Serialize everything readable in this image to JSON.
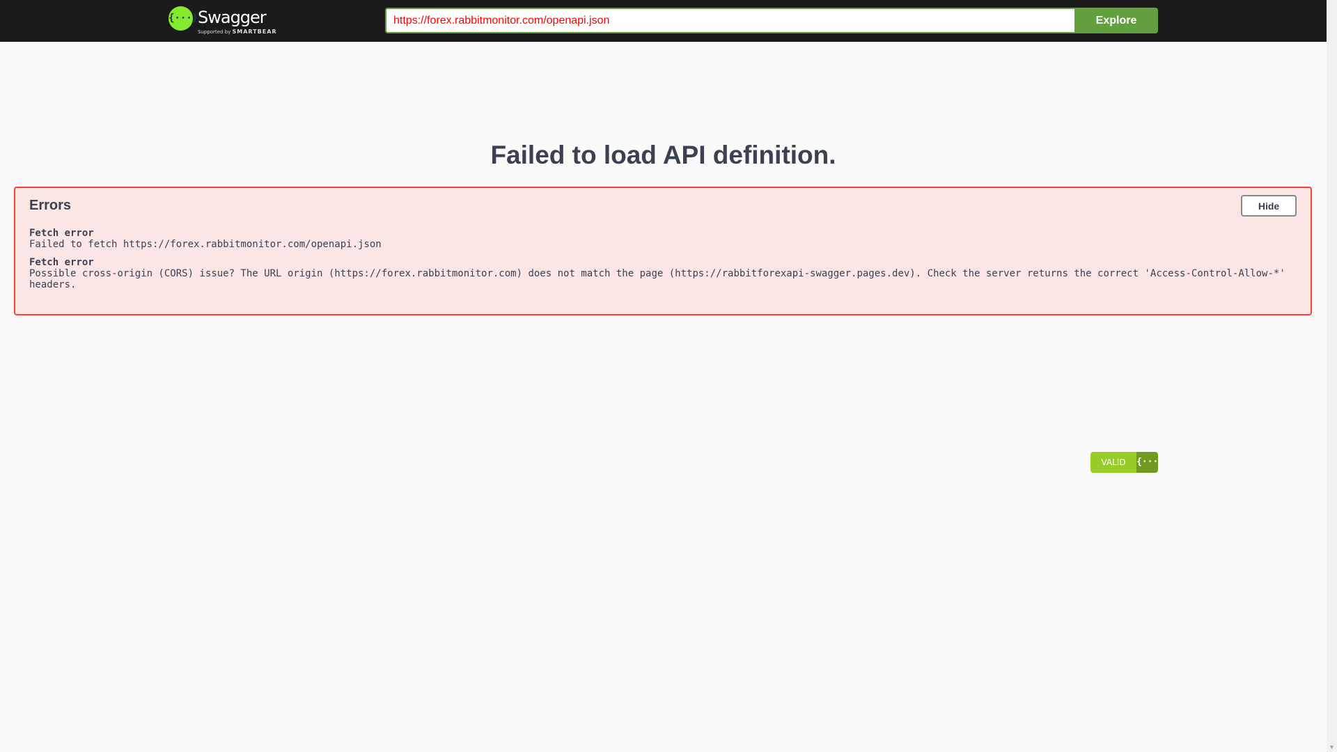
{
  "header": {
    "logo_text": "Swagger",
    "logo_sub_1": "Supported by",
    "logo_sub_2": "SMARTBEAR",
    "logo_glyph": "{···}",
    "url_value": "https://forex.rabbitmonitor.com/openapi.json",
    "explore_label": "Explore"
  },
  "main": {
    "title": "Failed to load API definition."
  },
  "errors": {
    "heading": "Errors",
    "hide_label": "Hide",
    "items": [
      {
        "title": "Fetch error",
        "message": "Failed to fetch https://forex.rabbitmonitor.com/openapi.json"
      },
      {
        "title": "Fetch error",
        "message": "Possible cross-origin (CORS) issue? The URL origin (https://forex.rabbitmonitor.com) does not match the page (https://rabbitforexapi-swagger.pages.dev). Check the server returns the correct 'Access-Control-Allow-*' headers."
      }
    ]
  },
  "validator": {
    "label": "VALID",
    "icon_glyph": "{···}"
  },
  "colors": {
    "accent": "#62a03f",
    "error_border": "#f93e3e",
    "error_bg": "#fbe5e5",
    "valid": "#96cb28"
  }
}
